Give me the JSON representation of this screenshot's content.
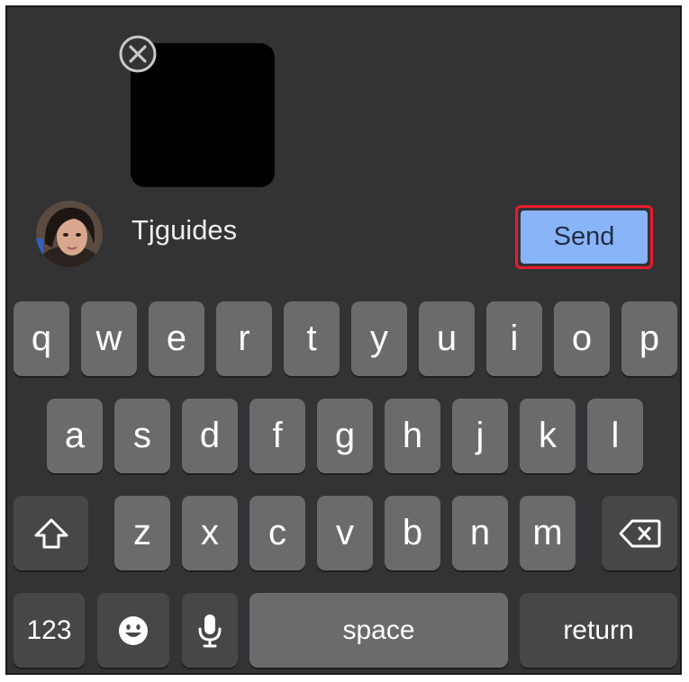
{
  "compose": {
    "recipient_name": "Tjguides",
    "send_label": "Send",
    "attachment_close_icon": "close-circle-icon",
    "avatar_icon": "avatar"
  },
  "keyboard": {
    "row1": [
      "q",
      "w",
      "e",
      "r",
      "t",
      "y",
      "u",
      "i",
      "o",
      "p"
    ],
    "row2": [
      "a",
      "s",
      "d",
      "f",
      "g",
      "h",
      "j",
      "k",
      "l"
    ],
    "row3": [
      "z",
      "x",
      "c",
      "v",
      "b",
      "n",
      "m"
    ],
    "shift_icon": "shift-icon",
    "backspace_icon": "backspace-icon",
    "numbers_label": "123",
    "emoji_icon": "emoji-icon",
    "mic_icon": "microphone-icon",
    "space_label": "space",
    "return_label": "return"
  },
  "colors": {
    "background": "#333336",
    "key": "#6b6b6d",
    "key_dark": "#47474a",
    "send_button": "#8ab4f8",
    "highlight": "#ea1c2b"
  }
}
